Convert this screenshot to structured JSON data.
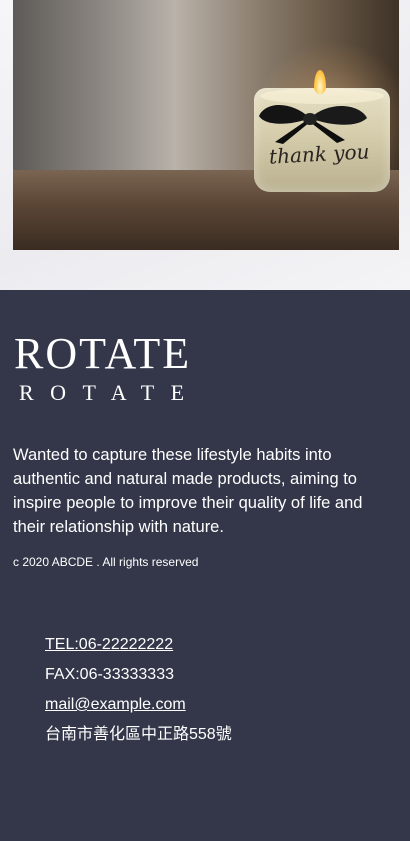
{
  "hero": {
    "image_alt": "Lit candle in a glass jar with a black ribbon bow",
    "jar_text": "thank you"
  },
  "footer": {
    "logo_main": "ROTATE",
    "logo_sub": "ROTATE",
    "description": "Wanted to capture these lifestyle habits into authentic and natural made products, aiming to inspire people to improve their quality of life and their relationship with nature.",
    "copyright": "c 2020 ABCDE . All rights reserved",
    "contact": {
      "tel": "TEL:06-22222222",
      "fax": "FAX:06-33333333",
      "email": "mail@example.com",
      "address": "台南市善化區中正路558號"
    }
  },
  "colors": {
    "footer_bg": "#333749",
    "text": "#ffffff",
    "page_bg": "#f2f2f4"
  }
}
